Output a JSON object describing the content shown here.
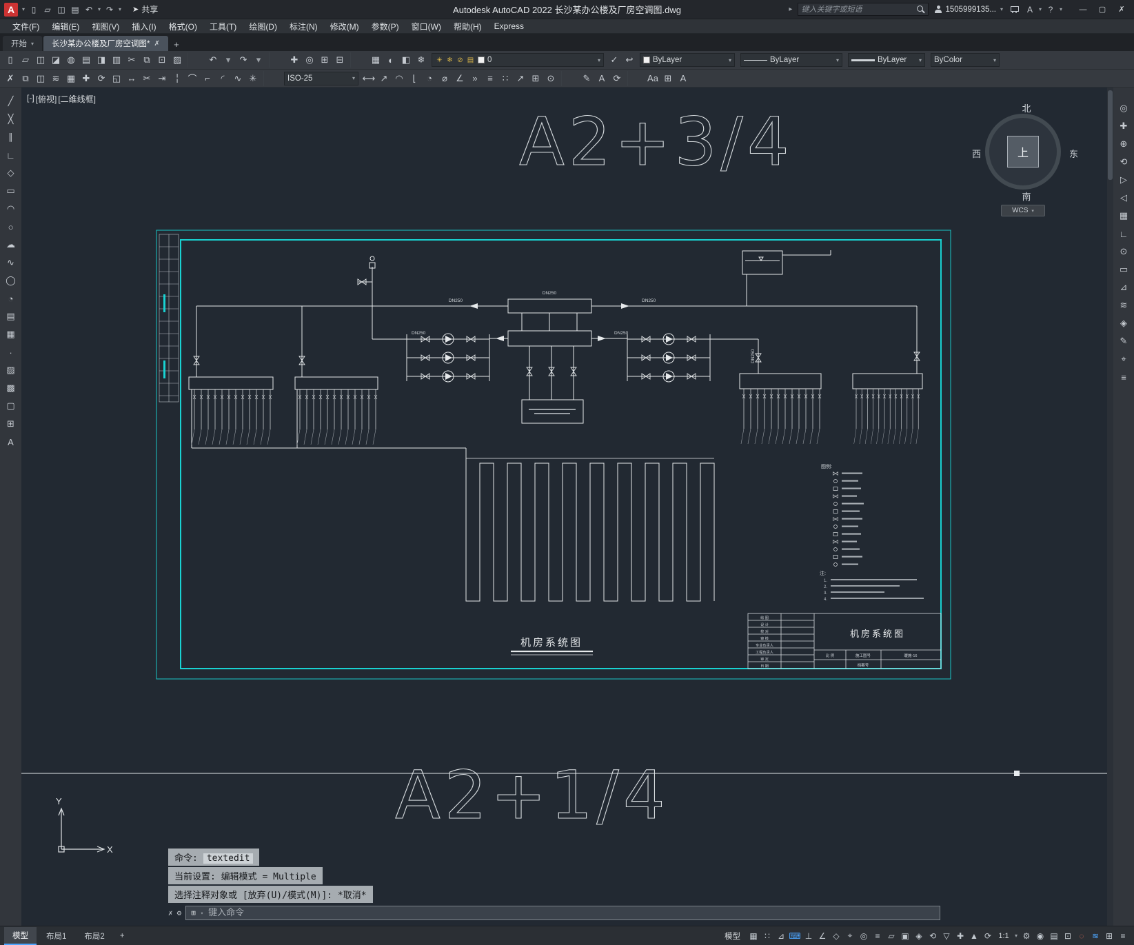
{
  "titlebar": {
    "logo": "A",
    "chev": "▾",
    "quick": [
      {
        "n": "app-menu",
        "g": "▾",
        "s": "chev"
      },
      {
        "n": "qnew",
        "g": "▯"
      },
      {
        "n": "open",
        "g": "▱"
      },
      {
        "n": "save",
        "g": "◫"
      },
      {
        "n": "plot",
        "g": "▤"
      },
      {
        "n": "undo",
        "g": "↶"
      },
      {
        "n": "undo-menu",
        "g": "▾",
        "s": "chev"
      },
      {
        "n": "redo",
        "g": "↷"
      },
      {
        "n": "redo-menu",
        "g": "▾",
        "s": "chev"
      }
    ],
    "share_glyph": "➤",
    "share_label": "共享",
    "title": "Autodesk AutoCAD 2022   长沙某办公楼及厂房空调图.dwg",
    "search_caret": "▸",
    "search_placeholder": "键入关键字或短语",
    "account": "1505999135...",
    "right_icons": [
      {
        "n": "cart",
        "g": ""
      },
      {
        "n": "autodesk-app",
        "g": "A"
      },
      {
        "n": "app-chevron",
        "g": "▾",
        "s": "chev"
      },
      {
        "n": "help",
        "g": "?"
      },
      {
        "n": "help-chevron",
        "g": "▾",
        "s": "chev"
      }
    ],
    "window": {
      "min": "—",
      "max": "▢",
      "close": "✗"
    }
  },
  "menubar": [
    {
      "n": "file",
      "label": "文件(F)"
    },
    {
      "n": "edit",
      "label": "编辑(E)"
    },
    {
      "n": "view",
      "label": "视图(V)"
    },
    {
      "n": "insert",
      "label": "插入(I)"
    },
    {
      "n": "format",
      "label": "格式(O)"
    },
    {
      "n": "tools",
      "label": "工具(T)"
    },
    {
      "n": "draw",
      "label": "绘图(D)"
    },
    {
      "n": "dimension",
      "label": "标注(N)"
    },
    {
      "n": "modify",
      "label": "修改(M)"
    },
    {
      "n": "parametric",
      "label": "参数(P)"
    },
    {
      "n": "window",
      "label": "窗口(W)"
    },
    {
      "n": "help",
      "label": "帮助(H)"
    },
    {
      "n": "express",
      "label": "Express"
    }
  ],
  "tabbar": {
    "start": "开始",
    "doc": "长沙某办公楼及厂房空调图*",
    "close_glyph": "✗",
    "add_glyph": "+"
  },
  "toolbar1": {
    "icons": [
      {
        "n": "qnew",
        "g": "▯"
      },
      {
        "n": "open",
        "g": "▱"
      },
      {
        "n": "save",
        "g": "◫"
      },
      {
        "n": "save-as",
        "g": "◪"
      },
      {
        "n": "web-open",
        "g": "◍"
      },
      {
        "n": "plot",
        "g": "▤"
      },
      {
        "n": "plot-preview",
        "g": "◨"
      },
      {
        "n": "publish",
        "g": "▥"
      },
      {
        "n": "cut",
        "g": "✂"
      },
      {
        "n": "copy-clip",
        "g": "⧉"
      },
      {
        "n": "paste",
        "g": "⊡"
      },
      {
        "n": "match-properties",
        "g": "▨"
      },
      {
        "n": "sep1",
        "s": "sep"
      },
      {
        "n": "undo",
        "g": "↶"
      },
      {
        "n": "undo-menu",
        "g": "▾",
        "s": "chev"
      },
      {
        "n": "redo",
        "g": "↷"
      },
      {
        "n": "redo-menu",
        "g": "▾",
        "s": "chev"
      },
      {
        "n": "sep2",
        "s": "sep"
      },
      {
        "n": "pan",
        "g": "✚"
      },
      {
        "n": "zoom-realtime",
        "g": "◎"
      },
      {
        "n": "zoom-window",
        "g": "⊞"
      },
      {
        "n": "zoom-previous",
        "g": "⊟"
      },
      {
        "n": "sep3",
        "s": "sep"
      },
      {
        "n": "layer-properties",
        "g": "▦"
      },
      {
        "n": "layer-off",
        "g": "◐"
      },
      {
        "n": "layer-isolate",
        "g": "◧"
      },
      {
        "n": "layer-freeze",
        "g": "❄"
      }
    ],
    "layer_combo_icons": [
      {
        "n": "layer-on",
        "g": "☀"
      },
      {
        "n": "layer-freeze",
        "g": "❄"
      },
      {
        "n": "layer-lock",
        "g": "⊘"
      },
      {
        "n": "layer-plot",
        "g": "▤"
      }
    ],
    "layer_value": "0",
    "icons2": [
      {
        "n": "make-current",
        "g": "✓"
      },
      {
        "n": "layer-previous",
        "g": "↩"
      }
    ],
    "color_value": "ByLayer",
    "linetype_value": "ByLayer",
    "lineweight_value": "ByLayer",
    "plotstyle_value": "ByColor"
  },
  "toolbar2": {
    "icons_a": [
      {
        "n": "erase",
        "g": "✗"
      },
      {
        "n": "copy",
        "g": "⧉"
      },
      {
        "n": "mirror",
        "g": "◫"
      },
      {
        "n": "offset",
        "g": "≋"
      },
      {
        "n": "array",
        "g": "▦"
      },
      {
        "n": "move",
        "g": "✚"
      },
      {
        "n": "rotate",
        "g": "⟳"
      },
      {
        "n": "scale",
        "g": "◱"
      },
      {
        "n": "stretch",
        "g": "↔"
      },
      {
        "n": "trim",
        "g": "✂"
      },
      {
        "n": "extend",
        "g": "⇥"
      },
      {
        "n": "break",
        "g": "╎"
      },
      {
        "n": "join",
        "g": "⌒"
      },
      {
        "n": "chamfer",
        "g": "⌐"
      },
      {
        "n": "fillet",
        "g": "◜"
      },
      {
        "n": "blend",
        "g": "∿"
      },
      {
        "n": "explode",
        "g": "✳"
      },
      {
        "n": "sep1",
        "s": "sep"
      }
    ],
    "dimstyle_value": "ISO-25",
    "icons_b": [
      {
        "n": "dim-linear",
        "g": "⟷"
      },
      {
        "n": "dim-aligned",
        "g": "↗"
      },
      {
        "n": "dim-arc",
        "g": "◠"
      },
      {
        "n": "dim-ordinate",
        "g": "⌊"
      },
      {
        "n": "dim-radius",
        "g": "◔"
      },
      {
        "n": "dim-diameter",
        "g": "⌀"
      },
      {
        "n": "dim-angular",
        "g": "∠"
      },
      {
        "n": "dim-quick",
        "g": "»"
      },
      {
        "n": "dim-baseline",
        "g": "≡"
      },
      {
        "n": "dim-continue",
        "g": "∷"
      },
      {
        "n": "leader",
        "g": "↗"
      },
      {
        "n": "tolerance",
        "g": "⊞"
      },
      {
        "n": "center-mark",
        "g": "⊙"
      },
      {
        "n": "sep2",
        "s": "sep"
      },
      {
        "n": "dim-edit",
        "g": "✎"
      },
      {
        "n": "dim-text-edit",
        "g": "A"
      },
      {
        "n": "dim-update",
        "g": "⟳"
      },
      {
        "n": "sep3",
        "s": "sep"
      },
      {
        "n": "text-style",
        "g": "Aa"
      },
      {
        "n": "table",
        "g": "⊞"
      },
      {
        "n": "mtext",
        "g": "A"
      }
    ]
  },
  "left_toolbar": [
    {
      "n": "line",
      "g": "╱"
    },
    {
      "n": "construction-line",
      "g": "╳"
    },
    {
      "n": "multiline",
      "g": "∥"
    },
    {
      "n": "polyline",
      "g": "∟"
    },
    {
      "n": "polygon",
      "g": "◇"
    },
    {
      "n": "rectangle",
      "g": "▭"
    },
    {
      "n": "arc",
      "g": "◠"
    },
    {
      "n": "circle",
      "g": "○"
    },
    {
      "n": "revision-cloud",
      "g": "☁"
    },
    {
      "n": "spline",
      "g": "∿"
    },
    {
      "n": "ellipse",
      "g": "◯"
    },
    {
      "n": "ellipse-arc",
      "g": "◔"
    },
    {
      "n": "insert-block",
      "g": "▤"
    },
    {
      "n": "make-block",
      "g": "▦"
    },
    {
      "n": "point",
      "g": "∙"
    },
    {
      "n": "hatch",
      "g": "▨"
    },
    {
      "n": "gradient",
      "g": "▩"
    },
    {
      "n": "region",
      "g": "▢"
    },
    {
      "n": "table",
      "g": "⊞"
    },
    {
      "n": "mtext",
      "g": "A"
    }
  ],
  "right_toolbar": [
    {
      "n": "full-nav-wheel",
      "g": "◎"
    },
    {
      "n": "pan",
      "g": "✚"
    },
    {
      "n": "zoom",
      "g": "⊕"
    },
    {
      "n": "orbit",
      "g": "⟲"
    },
    {
      "n": "show-motion",
      "g": "▷"
    },
    {
      "n": "view-back",
      "g": "◁"
    },
    {
      "n": "named-views",
      "g": "▦"
    },
    {
      "n": "ucs",
      "g": "∟"
    },
    {
      "n": "world-ucs",
      "g": "⊙"
    },
    {
      "n": "measure",
      "g": "▭"
    },
    {
      "n": "area",
      "g": "⊿"
    },
    {
      "n": "offset",
      "g": "≋"
    },
    {
      "n": "3d-osnap",
      "g": "◈"
    },
    {
      "n": "edit",
      "g": "✎"
    },
    {
      "n": "center",
      "g": "⌖"
    },
    {
      "n": "list",
      "g": "≡"
    }
  ],
  "viewport": {
    "menu": "[-]",
    "view": "[俯视]",
    "style": "[二维线框]"
  },
  "viewcube": {
    "north": "北",
    "south": "南",
    "east": "东",
    "west": "西",
    "top": "上",
    "wcs": "WCS"
  },
  "drawing": {
    "sheet_text_top": "A2+3/4",
    "sheet_text_bottom": "A2+1/4",
    "caption": "机房系统图",
    "pipe_labels": [
      "DN250",
      "DN250",
      "DN250",
      "DN250",
      "DN250",
      "DN250"
    ],
    "legend_title": "图例:",
    "notes_title": "注:",
    "note_numbers": [
      "1.",
      "2.",
      "3.",
      "4."
    ],
    "ucs_x": "X",
    "ucs_y": "Y",
    "title_block": {
      "rows": [
        "绘 图",
        "设 计",
        "校 对",
        "审 核",
        "专业负责人",
        "工程负责人",
        "审 定",
        "日 期"
      ],
      "title": "机房系统图",
      "scale_label": "比 例",
      "drawno_label": "施工图号",
      "drawno_value": "暖施-16",
      "archive_label": "档案号"
    }
  },
  "command": {
    "close_glyph": "✗",
    "wrench_glyph": "⚙",
    "menu_glyph": "⊞",
    "chev": "▾",
    "line1_label": "命令:",
    "line1_value": "textedit",
    "line2": "当前设置: 编辑模式 = Multiple",
    "line3": "选择注释对象或 [放弃(U)/模式(M)]: *取消*",
    "input_placeholder": "键入命令"
  },
  "statusbar": {
    "model_tab": "模型",
    "layout1": "布局1",
    "layout2": "布局2",
    "add_layout": "+",
    "model_label": "模型",
    "icons": [
      {
        "n": "grid",
        "g": "▦"
      },
      {
        "n": "snap",
        "g": "∷"
      },
      {
        "n": "infer-constraints",
        "g": "⊿"
      },
      {
        "n": "dynamic-input",
        "g": "⌨",
        "s": "on"
      },
      {
        "n": "ortho",
        "g": "⊥"
      },
      {
        "n": "polar-tracking",
        "g": "∠"
      },
      {
        "n": "isodraft",
        "g": "◇"
      },
      {
        "n": "osnap-tracking",
        "g": "⌖"
      },
      {
        "n": "osnap",
        "g": "◎"
      },
      {
        "n": "lineweight",
        "g": "≡"
      },
      {
        "n": "transparency",
        "g": "▱"
      },
      {
        "n": "selection-cycling",
        "g": "▣"
      },
      {
        "n": "3d-osnap",
        "g": "◈"
      },
      {
        "n": "dynamic-ucs",
        "g": "⟲"
      },
      {
        "n": "selection-filter",
        "g": "▽"
      },
      {
        "n": "gizmo",
        "g": "✚"
      },
      {
        "n": "annotation-visibility",
        "g": "▲"
      },
      {
        "n": "autoscale",
        "g": "⟳"
      },
      {
        "n": "annotation-scale",
        "g": "1:1",
        "s": "txt"
      },
      {
        "n": "scale-menu",
        "g": "▾",
        "s": "chev"
      },
      {
        "n": "workspace",
        "g": "⚙"
      },
      {
        "n": "annotation-monitor",
        "g": "◉"
      },
      {
        "n": "quick-properties",
        "g": "▤"
      },
      {
        "n": "lock-ui",
        "g": "⊡"
      },
      {
        "n": "isolate-objects",
        "g": "◌",
        "s": "warn"
      },
      {
        "n": "graphics-performance",
        "g": "≋",
        "s": "on"
      },
      {
        "n": "clean-screen",
        "g": "⊞"
      },
      {
        "n": "customize",
        "g": "≡"
      }
    ]
  }
}
